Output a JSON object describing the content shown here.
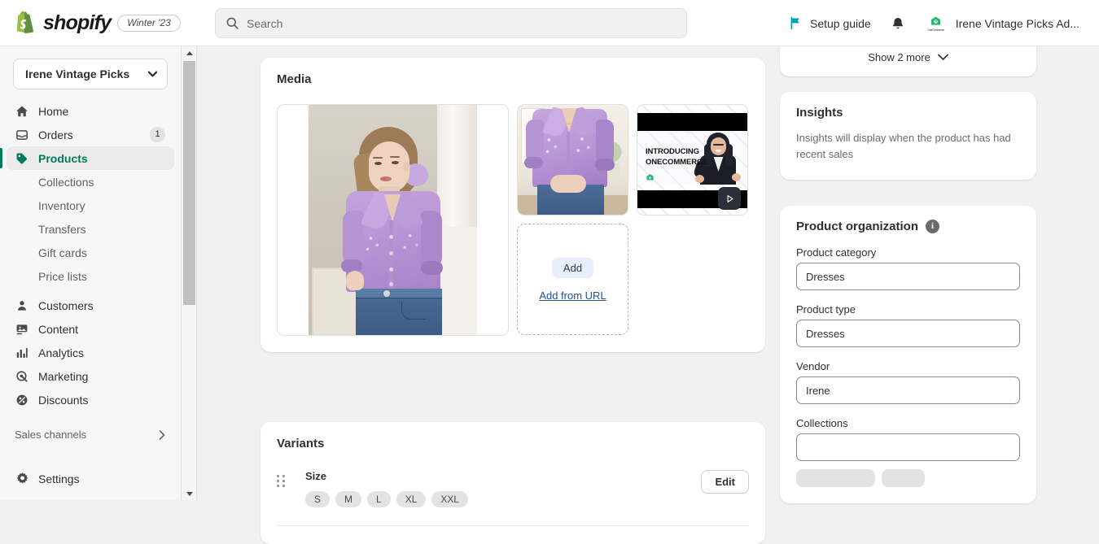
{
  "topbar": {
    "brand": "shopify",
    "season_badge": "Winter '23",
    "search_placeholder": "Search",
    "setup_guide_label": "Setup guide",
    "account_name": "Irene Vintage Picks Ad...",
    "icons": {
      "search": "search-icon",
      "flag": "flag-icon",
      "bell": "bell-icon",
      "avatar": "onecommerce-avatar-icon"
    },
    "avatar_caption": "OneCommerce"
  },
  "sidebar": {
    "store_name": "Irene Vintage Picks",
    "items": [
      {
        "label": "Home",
        "icon": "home-icon",
        "badge": ""
      },
      {
        "label": "Orders",
        "icon": "orders-icon",
        "badge": "1"
      },
      {
        "label": "Products",
        "icon": "products-tag-icon",
        "badge": "",
        "active": true
      }
    ],
    "subitems": [
      {
        "label": "Collections"
      },
      {
        "label": "Inventory"
      },
      {
        "label": "Transfers"
      },
      {
        "label": "Gift cards"
      },
      {
        "label": "Price lists"
      }
    ],
    "items2": [
      {
        "label": "Customers",
        "icon": "customer-icon"
      },
      {
        "label": "Content",
        "icon": "content-icon"
      },
      {
        "label": "Analytics",
        "icon": "analytics-bars-icon"
      },
      {
        "label": "Marketing",
        "icon": "marketing-target-icon"
      },
      {
        "label": "Discounts",
        "icon": "discount-tag-icon"
      }
    ],
    "section_label": "Sales channels",
    "settings_label": "Settings",
    "accent_color": "#007b5c"
  },
  "media": {
    "title": "Media",
    "add_button": "Add",
    "add_from_url": "Add from URL",
    "items": [
      {
        "type": "image",
        "alt": "Model wearing lavender embroidered blouse with blue jeans"
      },
      {
        "type": "image",
        "alt": "Close-up of lavender blouse detail"
      },
      {
        "type": "video",
        "alt": "Introducing OneCommerce promotional video"
      }
    ],
    "video_overlay_text_line1": "INTRODUCING",
    "video_overlay_text_line2": "ONECOMMERCE",
    "play_icon": "play-icon"
  },
  "variants": {
    "title": "Variants",
    "edit_label": "Edit",
    "option_name": "Size",
    "values": [
      "S",
      "M",
      "L",
      "XL",
      "XXL"
    ]
  },
  "right": {
    "show_more_label": "Show 2 more",
    "insights": {
      "title": "Insights",
      "body": "Insights will display when the product has had recent sales"
    },
    "organization": {
      "title": "Product organization",
      "info_icon": "info-icon",
      "fields": [
        {
          "label": "Product category",
          "value": "Dresses"
        },
        {
          "label": "Product type",
          "value": "Dresses"
        },
        {
          "label": "Vendor",
          "value": "Irene"
        },
        {
          "label": "Collections",
          "value": ""
        }
      ]
    }
  },
  "scrollbar": {
    "up": "scroll-up-arrow",
    "down": "scroll-down-arrow"
  }
}
